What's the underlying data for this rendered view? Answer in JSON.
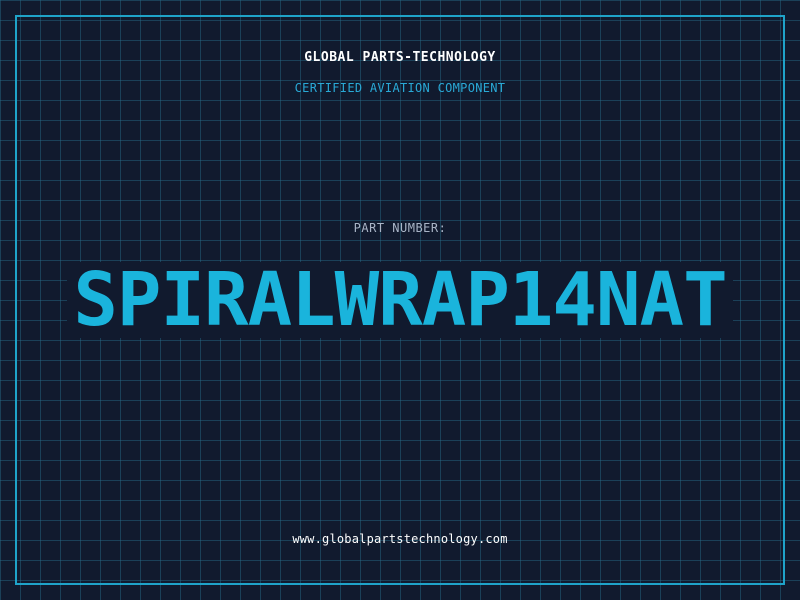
{
  "header": {
    "company_name": "GLOBAL PARTS-TECHNOLOGY",
    "tagline": "CERTIFIED AVIATION COMPONENT"
  },
  "part": {
    "label": "PART NUMBER:",
    "number": "SPIRALWRAP14NAT"
  },
  "footer": {
    "website": "www.globalpartstechnology.com"
  },
  "colors": {
    "background": "#111a2e",
    "grid": "#286e8c",
    "frame": "#1fa3c9",
    "accent": "#1ab4dc",
    "tagline": "#29a9d6",
    "label": "#a9b4c6",
    "text": "#ffffff"
  }
}
